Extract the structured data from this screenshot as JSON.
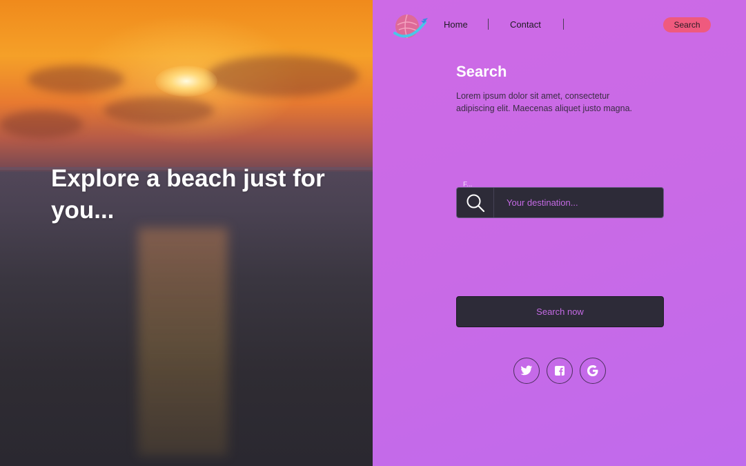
{
  "hero": {
    "title": "Explore a beach just for you..."
  },
  "nav": {
    "logo": "globe-plane-logo",
    "links": [
      "Home",
      "Contact"
    ],
    "search_label": "Search"
  },
  "main": {
    "title": "Search",
    "description": "Lorem ipsum dolor sit amet, consectetur adipiscing elit. Maecenas aliquet justo magna.",
    "field_label": "F...",
    "search_placeholder": "Your destination...",
    "submit_label": "Search now"
  },
  "social": {
    "icons": [
      "twitter-icon",
      "facebook-icon",
      "google-icon"
    ]
  },
  "colors": {
    "panel": "#c969e6",
    "accent_pink": "#ef5a7e",
    "dark_field": "#2d2b38",
    "field_text": "#c46ae4"
  }
}
